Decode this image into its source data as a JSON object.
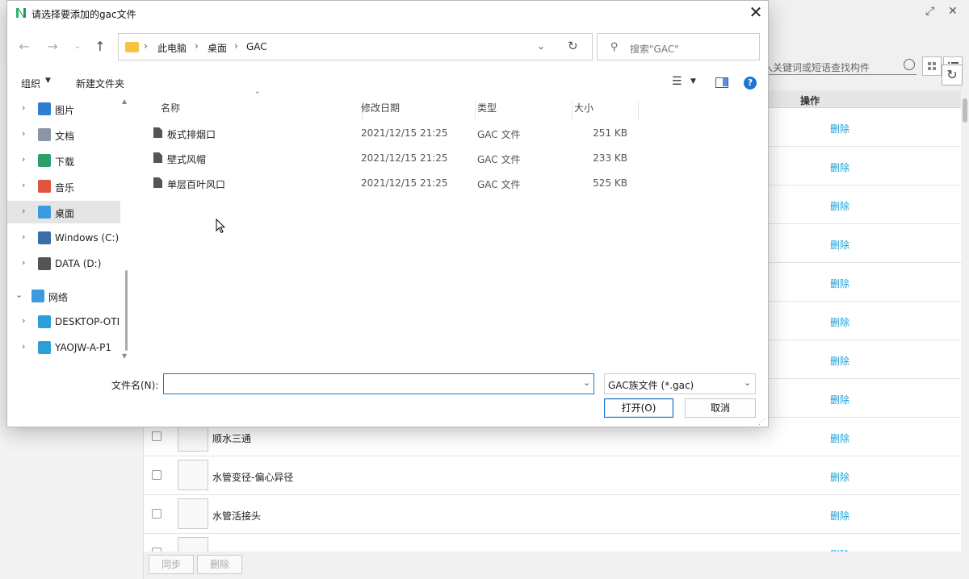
{
  "dialog": {
    "title": "请选择要添加的gac文件",
    "close": "✕",
    "breadcrumbs": [
      "此电脑",
      "桌面",
      "GAC"
    ],
    "search_placeholder": "搜索\"GAC\"",
    "organize": "组织",
    "new_folder": "新建文件夹",
    "columns": {
      "name": "名称",
      "date": "修改日期",
      "type": "类型",
      "size": "大小"
    },
    "files": [
      {
        "name": "板式排烟口",
        "date": "2021/12/15 21:25",
        "type": "GAC 文件",
        "size": "251 KB"
      },
      {
        "name": "壁式风帽",
        "date": "2021/12/15 21:25",
        "type": "GAC 文件",
        "size": "233 KB"
      },
      {
        "name": "单层百叶风口",
        "date": "2021/12/15 21:25",
        "type": "GAC 文件",
        "size": "525 KB"
      }
    ],
    "nav_tree": [
      {
        "label": "图片",
        "icon": "pictures-icon",
        "color": "#2f7fd0",
        "expanded": false
      },
      {
        "label": "文档",
        "icon": "documents-icon",
        "color": "#8a95a5",
        "expanded": false
      },
      {
        "label": "下载",
        "icon": "downloads-icon",
        "color": "#2aa06a",
        "expanded": false
      },
      {
        "label": "音乐",
        "icon": "music-icon",
        "color": "#e0553d",
        "expanded": false
      },
      {
        "label": "桌面",
        "icon": "desktop-icon",
        "color": "#3a9be0",
        "expanded": false,
        "selected": true
      },
      {
        "label": "Windows (C:)",
        "icon": "drive-c-icon",
        "color": "#3a6ea8",
        "expanded": false
      },
      {
        "label": "DATA (D:)",
        "icon": "drive-d-icon",
        "color": "#555555",
        "expanded": false
      },
      {
        "label": "网络",
        "icon": "network-icon",
        "color": "#3a9be0",
        "expanded": true
      },
      {
        "label": "DESKTOP-OTI",
        "icon": "computer-icon",
        "color": "#2aa0d8",
        "expanded": false
      },
      {
        "label": "YAOJW-A-P1",
        "icon": "computer-icon",
        "color": "#2aa0d8",
        "expanded": false
      }
    ],
    "filename_label": "文件名(N):",
    "filename_value": "",
    "filetype_selected": "GAC族文件 (*.gac)",
    "open_button": "打开(O)",
    "cancel_button": "取消"
  },
  "background": {
    "search_placeholder": "入关键词或短语查找构件",
    "column_operation": "操作",
    "delete_label": "删除",
    "rows": [
      {
        "name": ""
      },
      {
        "name": ""
      },
      {
        "name": ""
      },
      {
        "name": ""
      },
      {
        "name": ""
      },
      {
        "name": ""
      },
      {
        "name": ""
      },
      {
        "name": ""
      },
      {
        "name": "顺水三通"
      },
      {
        "name": "水管变径-偏心异径"
      },
      {
        "name": "水管活接头"
      },
      {
        "name": ""
      }
    ],
    "footer_sync": "同步",
    "footer_delete": "删除",
    "colors": {
      "accent": "#1a9fd6",
      "dialog_focus": "#1a75d2"
    }
  }
}
